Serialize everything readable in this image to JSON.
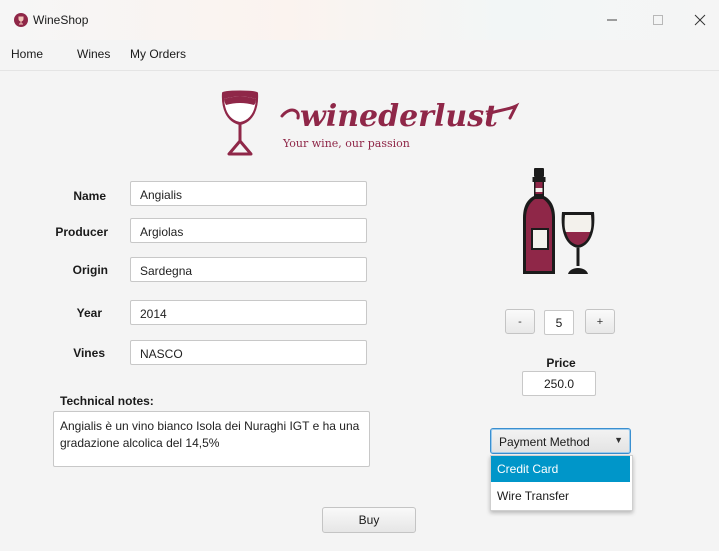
{
  "window": {
    "title": "WineShop"
  },
  "menu": {
    "items": [
      "Home",
      "Wines",
      "My Orders"
    ]
  },
  "brand": {
    "logo_text": "winederlust",
    "tagline": "Your wine, our passion",
    "color": "#8f2748"
  },
  "form": {
    "fields": [
      {
        "label": "Name",
        "value": "Angialis"
      },
      {
        "label": "Producer",
        "value": "Argiolas"
      },
      {
        "label": "Origin",
        "value": "Sardegna"
      },
      {
        "label": "Year",
        "value": "2014"
      },
      {
        "label": "Vines",
        "value": "NASCO"
      }
    ],
    "notes_label": "Technical notes:",
    "notes_value": "Angialis è un vino bianco Isola dei Nuraghi IGT e ha una gradazione alcolica del 14,5%"
  },
  "quantity": {
    "decrement_label": "-",
    "value": "5",
    "increment_label": "+"
  },
  "price": {
    "label": "Price",
    "value": "250.0"
  },
  "payment": {
    "placeholder": "Payment Method",
    "options": [
      "Credit Card",
      "Wire Transfer"
    ],
    "highlighted": "Credit Card",
    "highlight_color": "#0096c9"
  },
  "actions": {
    "buy_label": "Buy"
  }
}
